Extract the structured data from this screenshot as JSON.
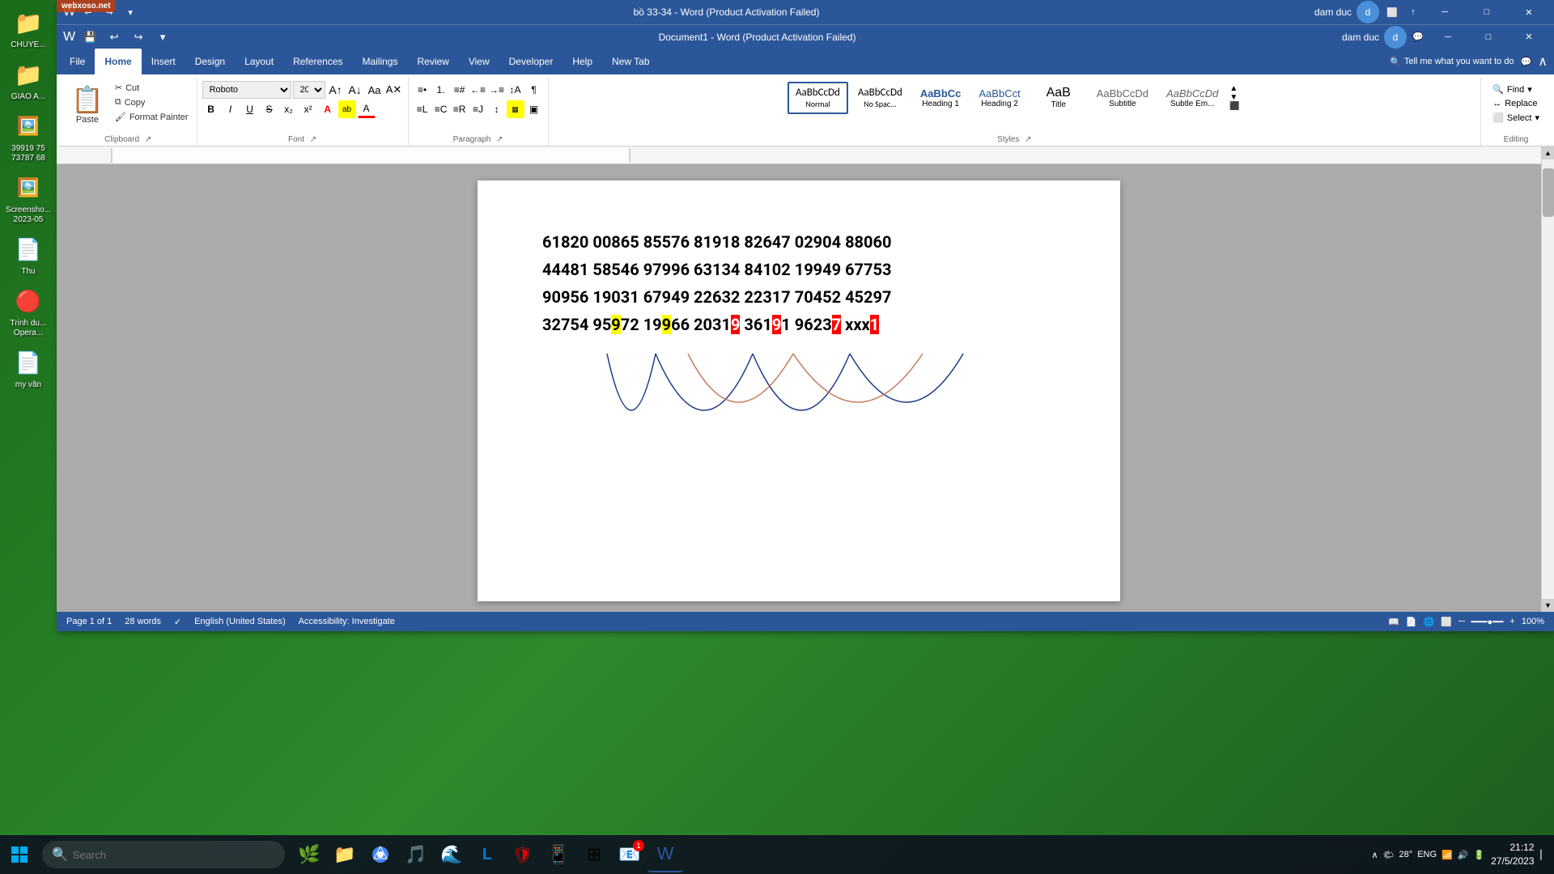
{
  "desktop": {
    "bg_color": "#2d7d2d",
    "icons_left": [
      {
        "label": "CHUYE...",
        "icon": "📁",
        "name": "folder-chuye"
      },
      {
        "label": "GIAO A...",
        "icon": "📁",
        "name": "folder-giao"
      },
      {
        "label": "39919 75\n73787 68",
        "icon": "🖼️",
        "name": "screenshot-icon"
      },
      {
        "label": "Screensho\n2023-05",
        "icon": "🖼️",
        "name": "screenshot2-icon"
      },
      {
        "label": "Thu",
        "icon": "📄",
        "name": "doc-thu"
      },
      {
        "label": "Trinh du\nOpera...",
        "icon": "🔴",
        "name": "opera-icon"
      },
      {
        "label": "my văn",
        "icon": "📄",
        "name": "doc-myvan"
      }
    ],
    "icons_tr": [
      {
        "icon": "📁",
        "name": "folder-tr1"
      },
      {
        "icon": "📁",
        "name": "folder-tr2"
      }
    ]
  },
  "word": {
    "title1": "bồ 33-34  -  Word (Product Activation Failed)",
    "title2": "Document1  -  Word (Product Activation Failed)",
    "user": "dam duc",
    "tabs": [
      "File",
      "Home",
      "Insert",
      "Design",
      "Layout",
      "References",
      "Mailings",
      "Review",
      "View",
      "Developer",
      "Help",
      "New Tab"
    ],
    "active_tab": "Home",
    "clipboard": {
      "paste": "Paste",
      "cut": "Cut",
      "copy": "Copy",
      "format_painter": "Format Painter",
      "label": "Clipboard"
    },
    "font": {
      "name": "Roboto",
      "size": "20",
      "label": "Font"
    },
    "paragraph_label": "Paragraph",
    "styles": {
      "label": "Styles",
      "items": [
        {
          "name": "Normal",
          "active": true
        },
        {
          "name": "No Spac...",
          "active": false
        },
        {
          "name": "Heading 1",
          "active": false
        },
        {
          "name": "Heading 2",
          "active": false
        },
        {
          "name": "Title",
          "active": false
        },
        {
          "name": "Subtitle",
          "active": false
        },
        {
          "name": "Subtle Em...",
          "active": false
        }
      ]
    },
    "editing": {
      "label": "Editing",
      "find": "Find",
      "replace": "Replace",
      "select": "Select"
    },
    "doc_lines": [
      {
        "text": "61820 00865 85576 81918 82647 02904 88060",
        "plain": true
      },
      {
        "text": "44481 58546 97996 63134 84102 19949 67753",
        "plain": true
      },
      {
        "text": "90956 19031 67949 22632 22317 70452 45297",
        "plain": true
      },
      {
        "text": "32754 959",
        "plain": true,
        "special_after": "72 199",
        "highlight_yellow": "66 2031",
        "highlight_red_first": "9",
        "after_red_first": " 3619",
        "highlight_red_second": "1",
        "after_red2": " 9623",
        "highlight_red_third": "7",
        "after_red3": " xxx",
        "highlight_red_end": "1"
      }
    ],
    "status": {
      "page": "Page 1 of 1",
      "words": "28 words",
      "language": "English (United States)",
      "accessibility": "Accessibility: Investigate",
      "zoom": "100%"
    }
  },
  "taskbar": {
    "search_placeholder": "Search",
    "time": "21:12",
    "date": "27/5/2023",
    "temp": "28°",
    "lang": "ENG"
  }
}
